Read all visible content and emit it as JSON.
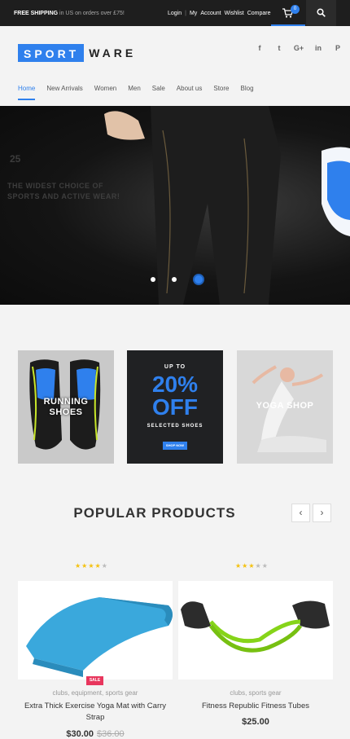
{
  "topbar": {
    "shipping_bold": "FREE SHIPPING",
    "shipping_text": "in US on orders over £75!",
    "links": [
      "Login",
      "|",
      "My",
      "Account",
      "Wishlist",
      "Compare"
    ],
    "cart_count": "0"
  },
  "logo": {
    "box_text": "SPORT",
    "rest_text": "WARE"
  },
  "social": [
    "f",
    "t",
    "G+",
    "in",
    "P"
  ],
  "nav": [
    "Home",
    "New Arrivals",
    "Women",
    "Men",
    "Sale",
    "About us",
    "Store",
    "Blog"
  ],
  "hero": {
    "number": "25",
    "tagline_1": "THE WIDEST CHOICE OF",
    "tagline_2": "SPORTS AND ACTIVE WEAR!"
  },
  "banners": {
    "running_1": "RUNNING",
    "running_2": "SHOES",
    "up_to": "UP TO",
    "percent_1": "20%",
    "percent_2": "OFF",
    "selected": "SELECTED SHOES",
    "shop_now": "SHOP NOW",
    "yoga": "YOGA SHOP"
  },
  "popular": {
    "title": "POPULAR PRODUCTS",
    "prev": "‹",
    "next": "›"
  },
  "products": [
    {
      "stars": "★★★★",
      "stars_off": "★",
      "sale": "SALE",
      "category": "clubs, equipment, sports gear",
      "name": "Extra Thick Exercise Yoga Mat with Carry Strap",
      "price": "$30.00",
      "old_price": "$36.00"
    },
    {
      "stars": "★★★",
      "stars_off": "★★",
      "category": "clubs, sports gear",
      "name": "Fitness Republic Fitness Tubes",
      "price": "$25.00"
    }
  ],
  "colors": {
    "accent": "#2f80ed",
    "sale": "#e8365d",
    "dark": "#1e1e1e"
  }
}
